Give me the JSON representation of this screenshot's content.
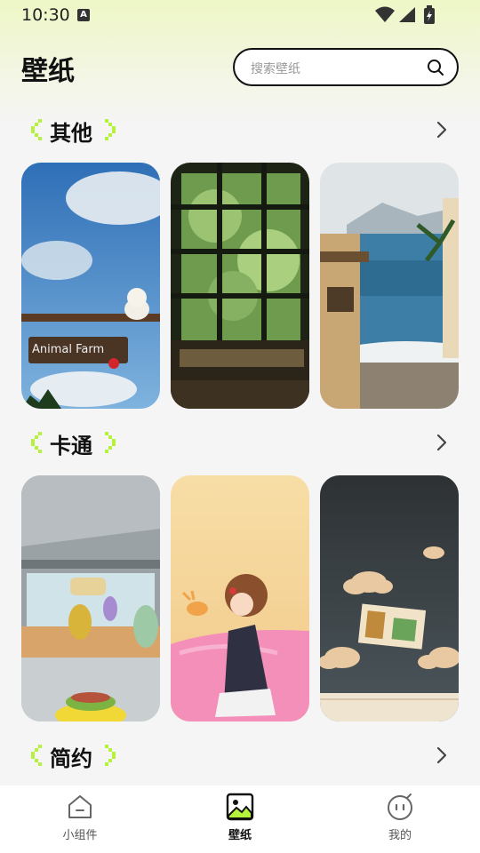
{
  "status_bar": {
    "time": "10:30"
  },
  "header": {
    "title": "壁纸"
  },
  "search": {
    "placeholder": "搜索壁纸"
  },
  "sections": [
    {
      "title": "其他",
      "cards": [
        "animal-farm-sky",
        "greenhouse-window",
        "seaside-alley"
      ]
    },
    {
      "title": "卡通",
      "cards": [
        "cartoon-restaurant",
        "anime-girl-pink",
        "toy-clouds-wall"
      ]
    },
    {
      "title": "简约",
      "cards": []
    }
  ],
  "bottom_nav": {
    "items": [
      {
        "label": "小组件",
        "icon": "widget-icon",
        "active": false
      },
      {
        "label": "壁纸",
        "icon": "wallpaper-icon",
        "active": true
      },
      {
        "label": "我的",
        "icon": "profile-icon",
        "active": false
      }
    ]
  },
  "colors": {
    "accent": "#b6f23c",
    "text": "#111111",
    "background": "#f5f5f5"
  }
}
